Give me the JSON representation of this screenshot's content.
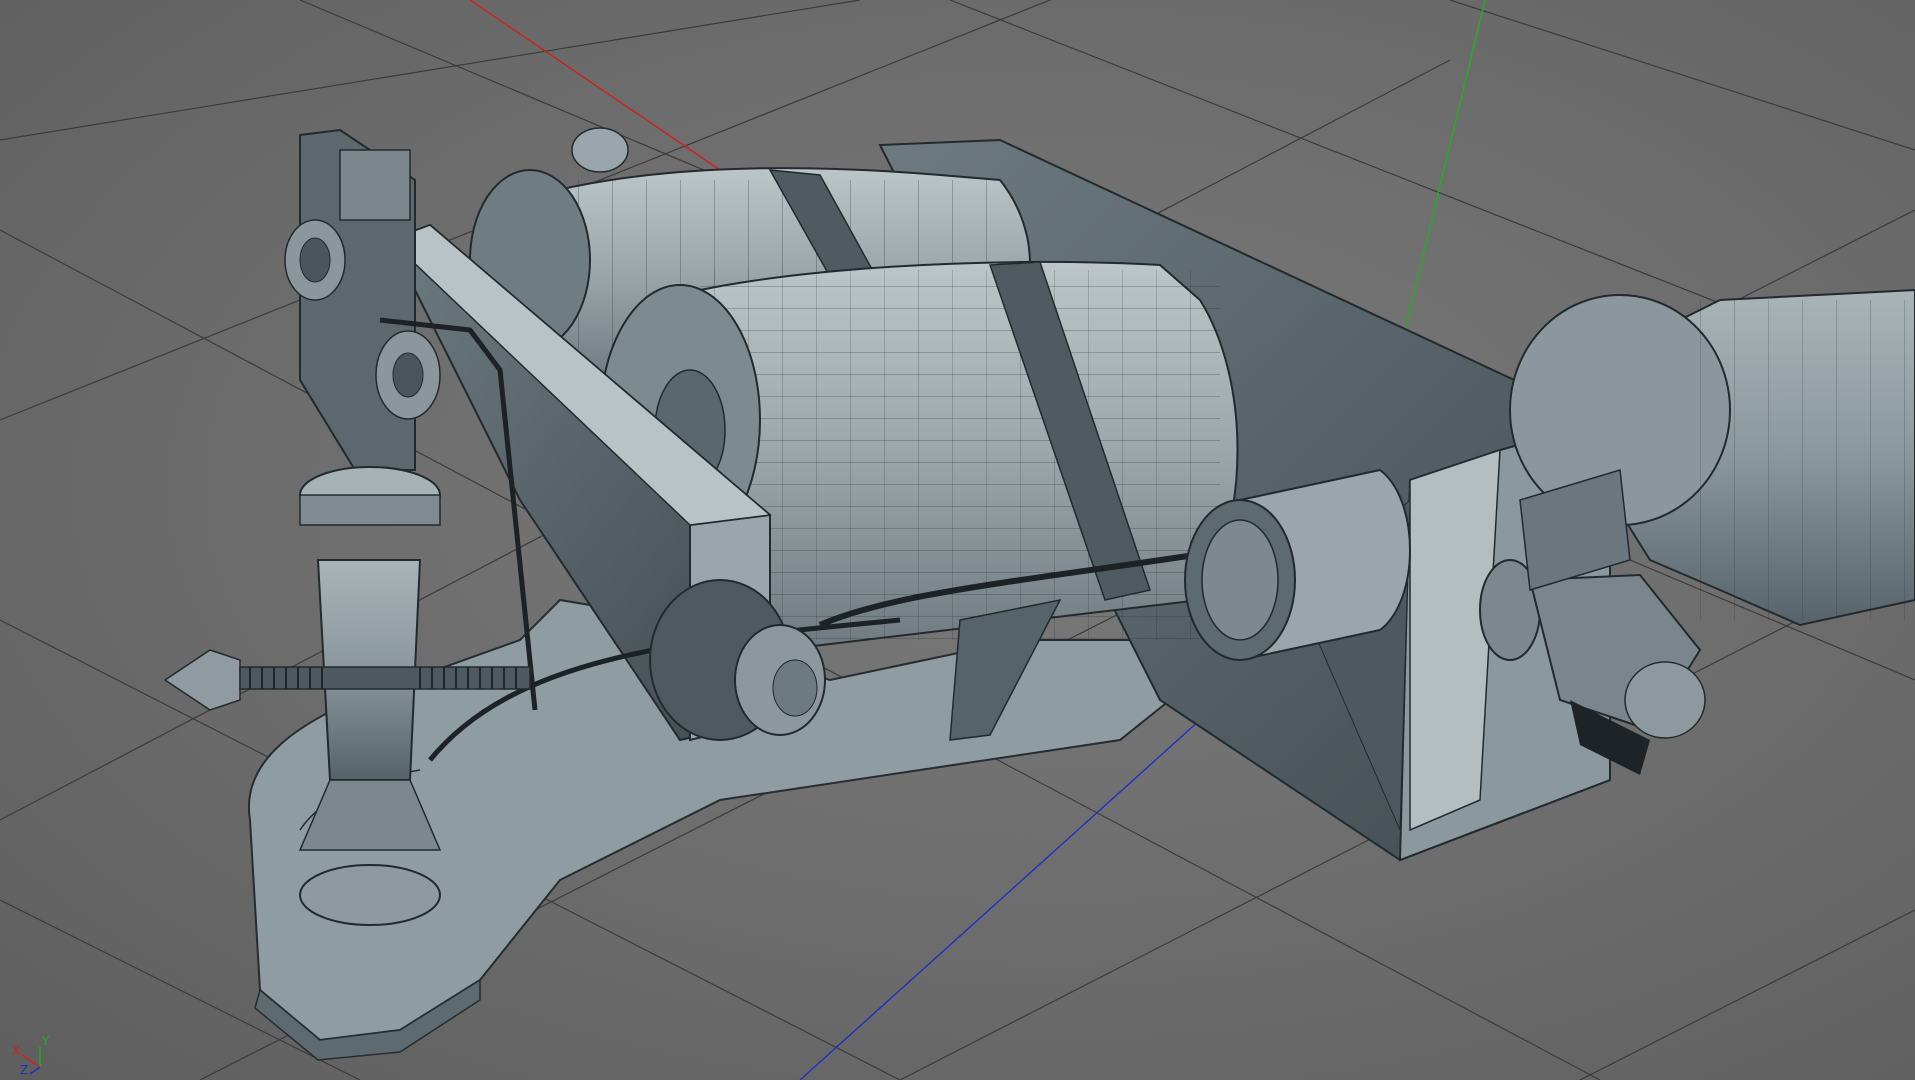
{
  "viewport": {
    "background_color": "#6b6b6b",
    "grid_color": "#3a3a3a",
    "mesh_color": "#93a0a4",
    "wire_color": "#222a2d",
    "axes": {
      "x_color": "#d02020",
      "y_color": "#20b020",
      "z_color": "#2030c0"
    }
  },
  "axis_gizmo": {
    "x_label": "X",
    "y_label": "Y",
    "z_label": "Z"
  },
  "scene": {
    "objects": [
      "base-plate",
      "coil-back",
      "coil-front",
      "armature-bar",
      "frame-rail",
      "binding-post",
      "adjust-screw",
      "grip-tube",
      "tube-clamp",
      "spring-wire"
    ]
  }
}
